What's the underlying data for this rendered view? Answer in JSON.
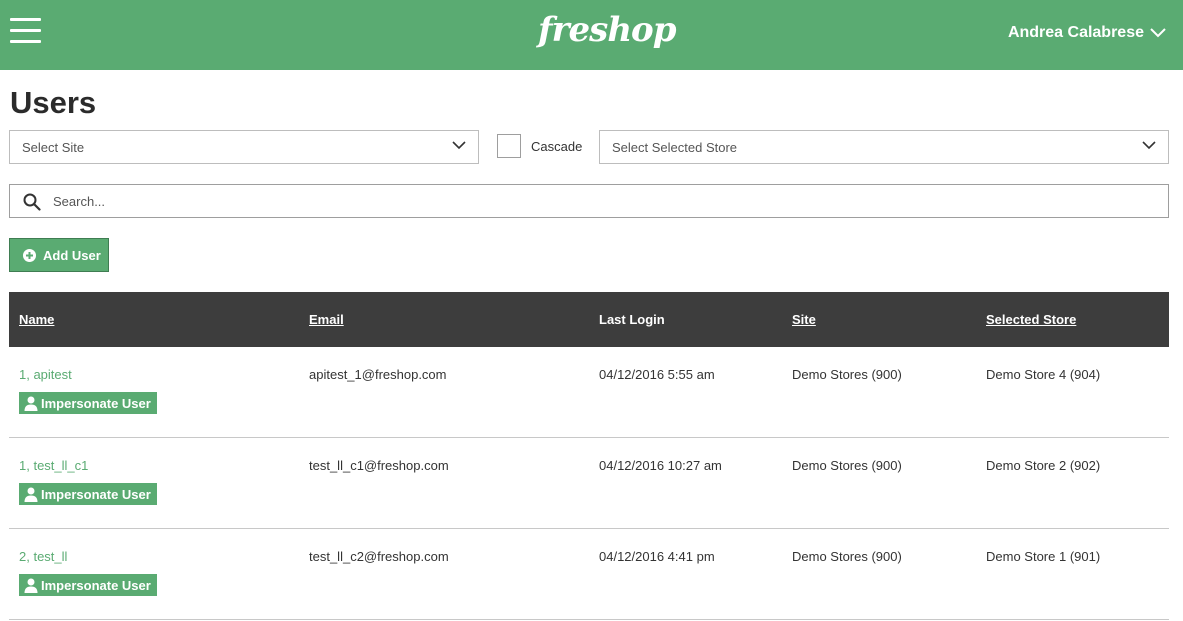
{
  "header": {
    "logo": "freshop",
    "user_name": "Andrea Calabrese"
  },
  "page": {
    "title": "Users"
  },
  "filters": {
    "site_placeholder": "Select Site",
    "cascade_label": "Cascade",
    "cascade_checked": false,
    "store_placeholder": "Select Selected Store",
    "search_placeholder": "Search..."
  },
  "actions": {
    "add_user_label": "Add User"
  },
  "table": {
    "columns": [
      "Name",
      "Email",
      "Last Login",
      "Site",
      "Selected Store"
    ],
    "impersonate_label": "Impersonate User",
    "rows": [
      {
        "name": "1, apitest",
        "email": "apitest_1@freshop.com",
        "last_login": "04/12/2016 5:55 am",
        "site": "Demo Stores (900)",
        "store": "Demo Store 4 (904)"
      },
      {
        "name": "1, test_ll_c1",
        "email": "test_ll_c1@freshop.com",
        "last_login": "04/12/2016 10:27 am",
        "site": "Demo Stores (900)",
        "store": "Demo Store 2 (902)"
      },
      {
        "name": "2, test_ll",
        "email": "test_ll_c2@freshop.com",
        "last_login": "04/12/2016 4:41 pm",
        "site": "Demo Stores (900)",
        "store": "Demo Store 1 (901)"
      }
    ]
  },
  "icons": {
    "menu": "hamburger-menu-icon",
    "dropdown": "chevron-down-icon",
    "search": "search-icon",
    "add": "plus-circle-icon",
    "impersonate": "user-icon"
  },
  "colors": {
    "brand_green": "#5aab72",
    "header_dark": "#3d3d3d"
  }
}
